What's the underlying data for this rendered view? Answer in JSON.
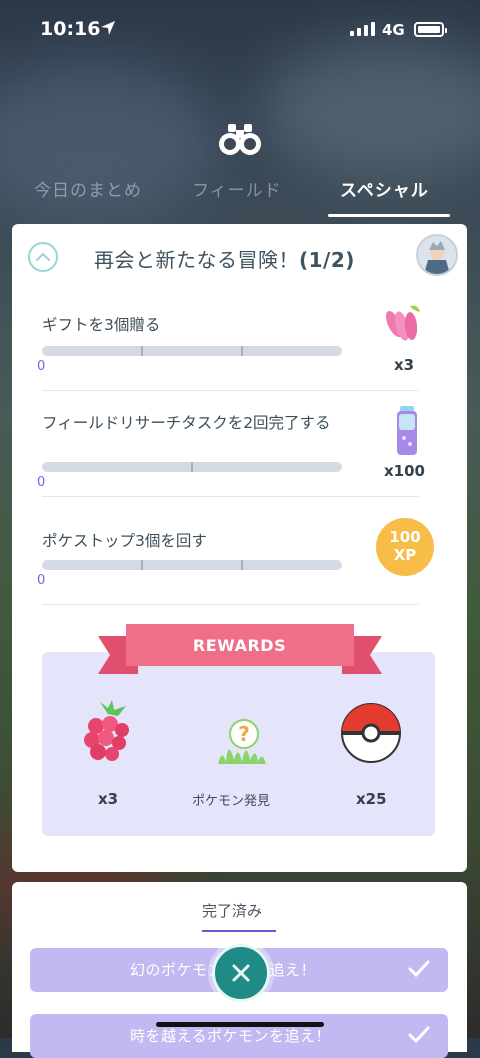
{
  "status_bar": {
    "time": "10:16",
    "network": "4G"
  },
  "tabs": [
    {
      "label": "今日のまとめ",
      "active": false
    },
    {
      "label": "フィールド",
      "active": false
    },
    {
      "label": "スペシャル",
      "active": true
    }
  ],
  "research": {
    "title": "再会と新たなる冒険！",
    "step": "(1/2)",
    "tasks": [
      {
        "text": "ギフトを3個贈る",
        "progress": "0",
        "reward_qty": "x3",
        "reward_icon": "pinap-berry-icon"
      },
      {
        "text": "フィールドリサーチタスクを2回完了する",
        "progress": "0",
        "reward_qty": "x100",
        "reward_icon": "stardust-icon"
      },
      {
        "text": "ポケストップ3個を回す",
        "progress": "0",
        "reward_qty": "100\nXP",
        "reward_icon": "xp-icon"
      }
    ],
    "rewards": {
      "banner": "REWARDS",
      "items": [
        {
          "label": "x3",
          "icon": "razz-berry-icon"
        },
        {
          "label": "ポケモン発見",
          "icon": "mystery-pokemon-encounter-icon"
        },
        {
          "label": "x25",
          "icon": "poke-ball-icon"
        }
      ]
    }
  },
  "completed": {
    "section_label": "完了済み",
    "items": [
      {
        "label": "幻のポケモンの姿を追え！"
      },
      {
        "label": "時を越えるポケモンを追え！"
      }
    ]
  },
  "colors": {
    "accent": "#7a62e0",
    "ribbon": "#ef6f88",
    "rewards_bg": "#e4e4fb",
    "close_button": "#1f8a86"
  }
}
